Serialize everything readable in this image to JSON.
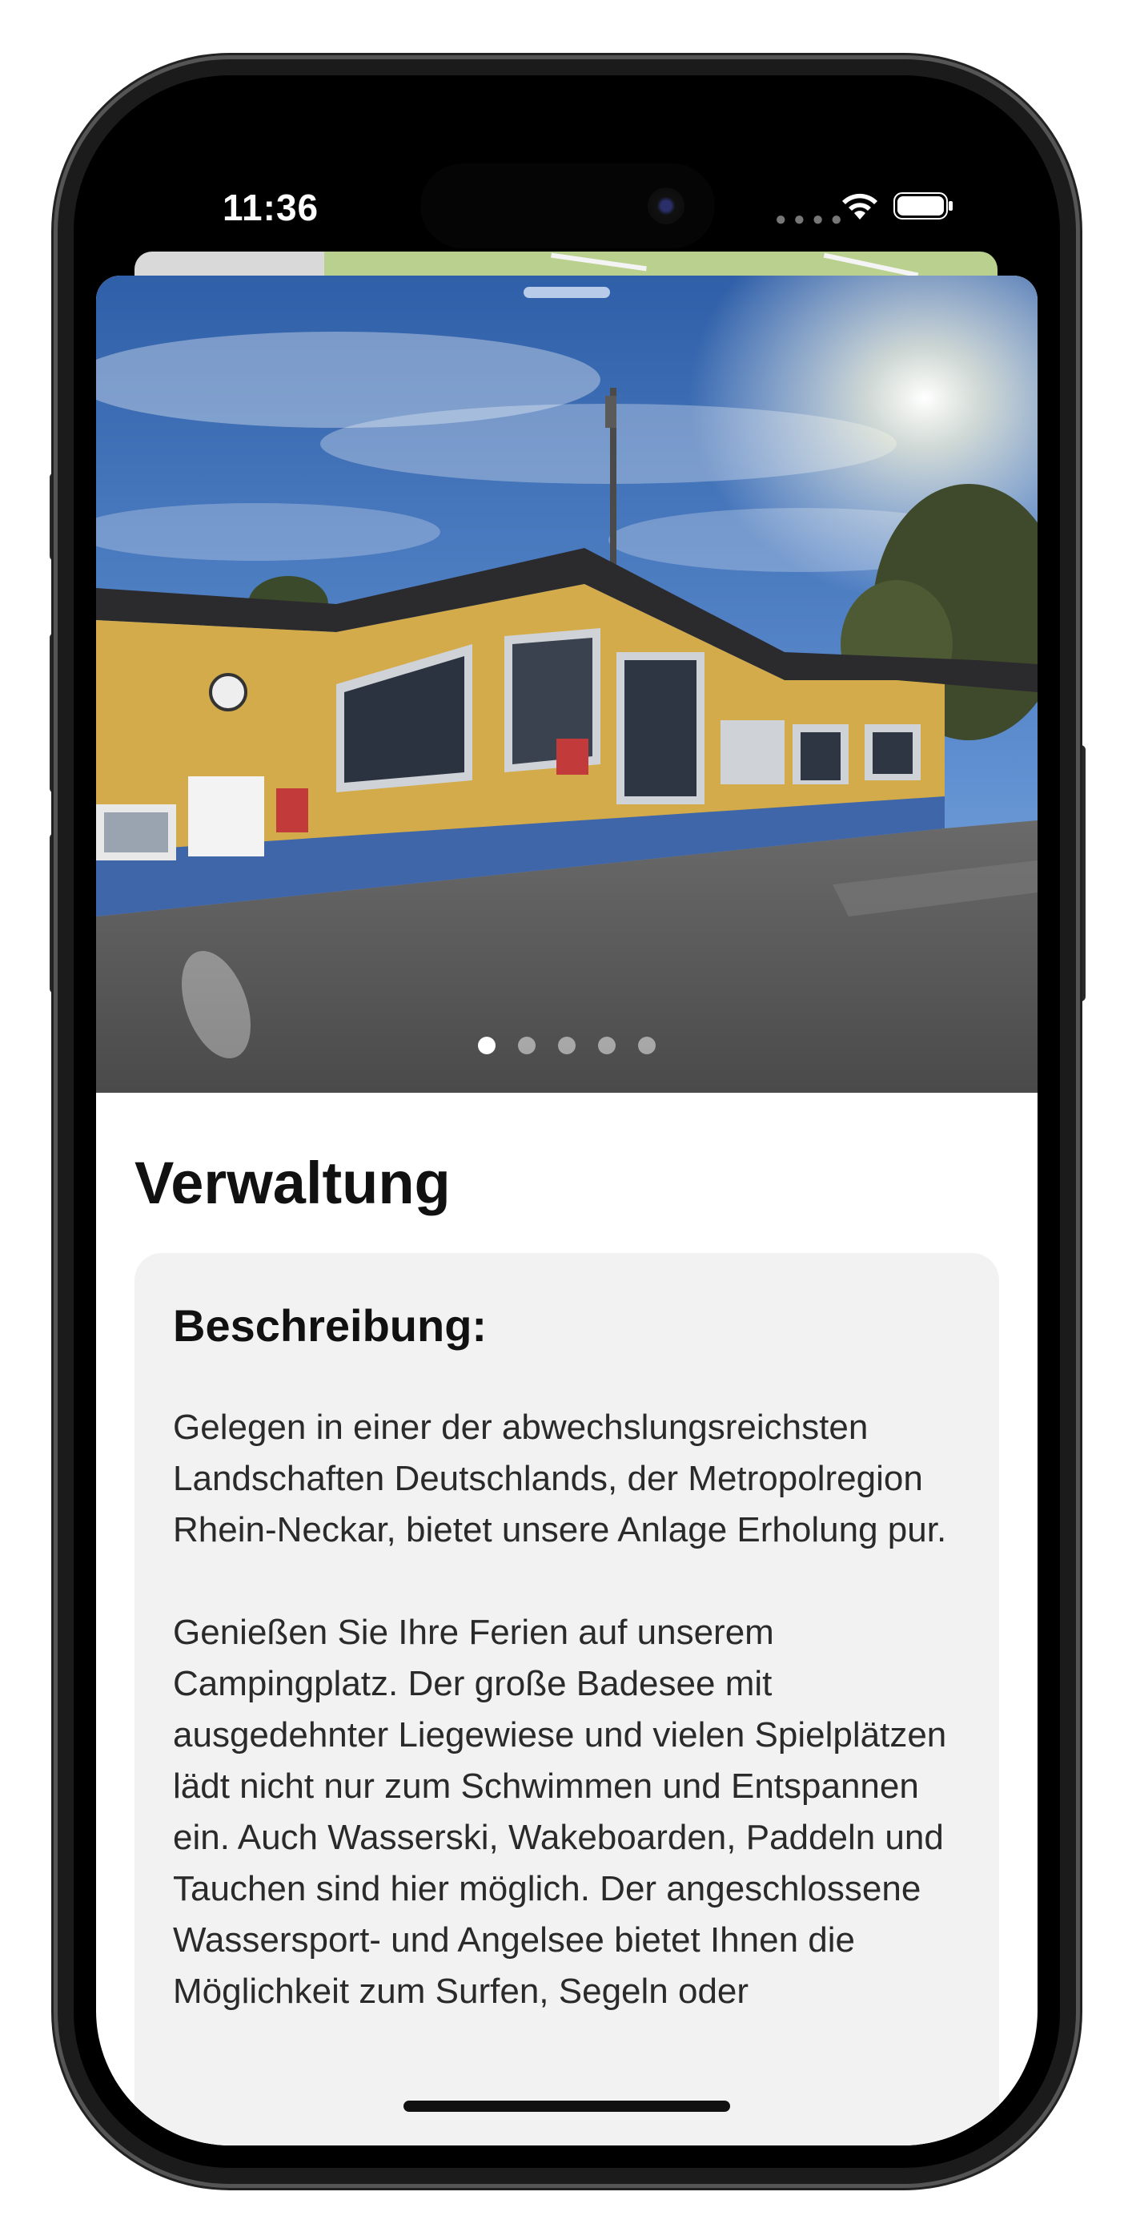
{
  "status_bar": {
    "time": "11:36",
    "icons": [
      "cellular-dots-icon",
      "wifi-icon",
      "battery-icon"
    ]
  },
  "detail": {
    "title": "Verwaltung",
    "image_carousel": {
      "page_count": 5,
      "active_page": 1
    },
    "description_card": {
      "heading": "Beschreibung:",
      "paragraph_1": "Gelegen in einer der abwechslungsreichsten Landschaften Deutschlands, der Metropolregion Rhein-Neckar, bietet unsere Anlage Erholung pur.",
      "paragraph_2": "Genießen Sie Ihre Ferien auf unserem Campingplatz. Der große Badesee mit ausgedehnter Liegewiese und vielen Spielplätzen lädt nicht nur zum Schwimmen und Entspannen ein. Auch Wasserski, Wakeboarden, Paddeln und Tauchen sind hier möglich. Der angeschlossene Wassersport- und Angelsee bietet Ihnen die Möglichkeit zum Surfen, Segeln oder"
    }
  },
  "colors": {
    "sky_top": "#2f5fa8",
    "sky_bottom": "#8fb6e6",
    "wall_yellow": "#d3ab4a",
    "wall_blue": "#3e66a8",
    "card_bg": "#f2f2f2",
    "map_green": "#b9d08f"
  }
}
